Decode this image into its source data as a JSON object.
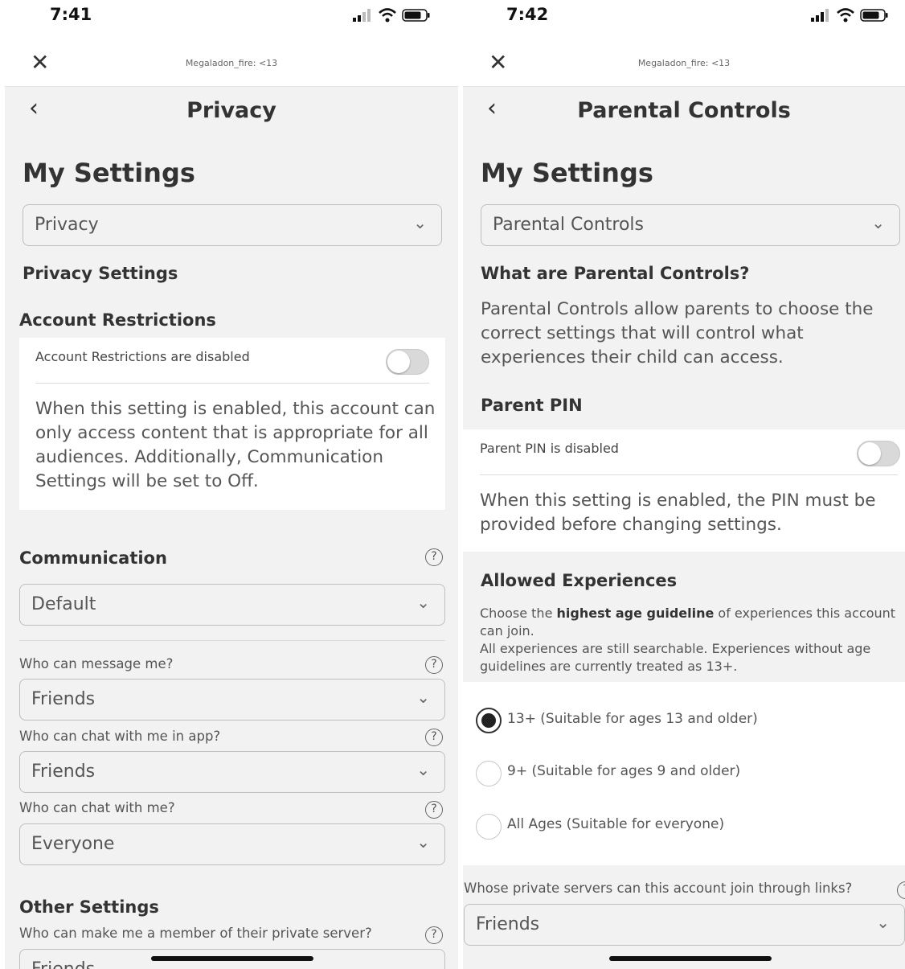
{
  "left": {
    "status": {
      "time": "7:41"
    },
    "username": "Megaladon_fire: <13",
    "nav_title": "Privacy",
    "my_settings": "My Settings",
    "category_select": "Privacy",
    "privacy_settings": "Privacy Settings",
    "account_restrictions": {
      "heading": "Account Restrictions",
      "toggle_label": "Account Restrictions are disabled",
      "description": "When this setting is enabled, this account can only access content that is appropriate for all audiences. Additionally, Communication Settings will be set to Off."
    },
    "communication": {
      "heading": "Communication",
      "preset": "Default",
      "fields": [
        {
          "label": "Who can message me?",
          "value": "Friends"
        },
        {
          "label": "Who can chat with me in app?",
          "value": "Friends"
        },
        {
          "label": "Who can chat with me?",
          "value": "Everyone"
        }
      ]
    },
    "other_settings": {
      "heading": "Other Settings",
      "label": "Who can make me a member of their private server?",
      "value": "Friends"
    }
  },
  "right": {
    "status": {
      "time": "7:42"
    },
    "username": "Megaladon_fire: <13",
    "nav_title": "Parental Controls",
    "my_settings": "My Settings",
    "category_select": "Parental Controls",
    "what_heading": "What are Parental Controls?",
    "what_text": "Parental Controls allow parents to choose the correct settings that will control what experiences their child can access.",
    "parent_pin": {
      "heading": "Parent PIN",
      "toggle_label": "Parent PIN is disabled",
      "description": "When this setting is enabled, the PIN must be provided before changing settings."
    },
    "allowed_experiences": {
      "heading": "Allowed Experiences",
      "desc_prefix": "Choose the ",
      "desc_bold": "highest age guideline",
      "desc_suffix": " of experiences this account can join.",
      "desc_line2": "All experiences are still searchable. Experiences without age guidelines are currently treated as 13+.",
      "options": [
        {
          "label": "13+ (Suitable for ages 13 and older)",
          "selected": true
        },
        {
          "label": "9+ (Suitable for ages 9 and older)",
          "selected": false
        },
        {
          "label": "All Ages (Suitable for everyone)",
          "selected": false
        }
      ]
    },
    "private_servers": {
      "label": "Whose private servers can this account join through links?",
      "value": "Friends"
    }
  }
}
